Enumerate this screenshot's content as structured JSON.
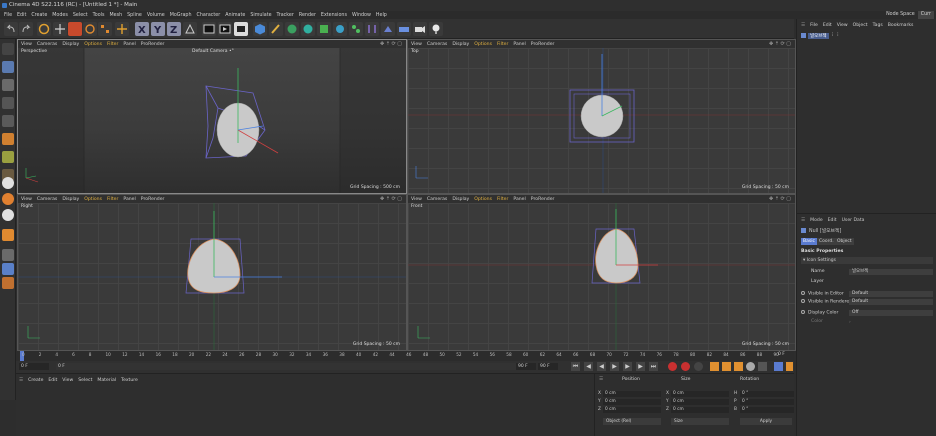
{
  "window": {
    "title": "Cinema 4D S22.116 (RC) - [Untitled 1 *] - Main"
  },
  "menu": [
    "File",
    "Edit",
    "Create",
    "Modes",
    "Select",
    "Tools",
    "Mesh",
    "Spline",
    "Volume",
    "MoGraph",
    "Character",
    "Animate",
    "Simulate",
    "Tracker",
    "Render",
    "Extensions",
    "Window",
    "Help"
  ],
  "layout": {
    "label": "Node Space",
    "value": "Curr"
  },
  "viewport_menu": [
    "View",
    "Cameras",
    "Display",
    "Options",
    "Filter",
    "Panel",
    "ProRender"
  ],
  "viewports": [
    {
      "label": "Perspective",
      "camera": "Default Camera •°",
      "grid": "Grid Spacing : 500 cm"
    },
    {
      "label": "Top",
      "camera": "",
      "grid": "Grid Spacing : 50 cm"
    },
    {
      "label": "Right",
      "camera": "",
      "grid": "Grid Spacing : 50 cm"
    },
    {
      "label": "Front",
      "camera": "",
      "grid": "Grid Spacing : 50 cm"
    }
  ],
  "timeline": {
    "ticks": [
      "0",
      "2",
      "4",
      "6",
      "8",
      "10",
      "12",
      "14",
      "16",
      "18",
      "20",
      "22",
      "24",
      "26",
      "28",
      "30",
      "32",
      "34",
      "36",
      "38",
      "40",
      "42",
      "44",
      "46",
      "48",
      "50",
      "52",
      "54",
      "56",
      "58",
      "60",
      "62",
      "64",
      "66",
      "68",
      "70",
      "72",
      "74",
      "76",
      "78",
      "80",
      "82",
      "84",
      "86",
      "88",
      "90"
    ],
    "current": "0 F"
  },
  "transport": {
    "start": "0 F",
    "start2": "0 F",
    "end": "90 F",
    "end2": "90 F"
  },
  "material_menu": [
    "Create",
    "Edit",
    "View",
    "Select",
    "Material",
    "Texture"
  ],
  "coords": {
    "headers": [
      "Position",
      "Size",
      "Rotation"
    ],
    "rows": [
      {
        "axis": "X",
        "pos": "0 cm",
        "size_axis": "X",
        "size": "0 cm",
        "rot_axis": "H",
        "rot": "0 °"
      },
      {
        "axis": "Y",
        "pos": "0 cm",
        "size_axis": "Y",
        "size": "0 cm",
        "rot_axis": "P",
        "rot": "0 °"
      },
      {
        "axis": "Z",
        "pos": "0 cm",
        "size_axis": "Z",
        "size": "0 cm",
        "rot_axis": "B",
        "rot": "0 °"
      }
    ],
    "mode": "Object (Rel)",
    "size_mode": "Size",
    "apply": "Apply"
  },
  "object_manager": {
    "menu": [
      "File",
      "Edit",
      "View",
      "Object",
      "Tags",
      "Bookmarks"
    ],
    "item": "널오브젝"
  },
  "attributes": {
    "menu": [
      "Mode",
      "Edit",
      "User Data"
    ],
    "object_title": "Null [널오브젝]",
    "tabs": [
      "Basic",
      "Coord.",
      "Object"
    ],
    "section": "Basic Properties",
    "subsection": "▾ Icon Settings",
    "name_label": "Name",
    "name_value": "널오브젝",
    "layer_label": "Layer",
    "vis_editor_label": "Visible in Editor",
    "vis_editor_value": "Default",
    "vis_render_label": "Visible in Renderer",
    "vis_render_value": "Default",
    "display_color_label": "Display Color",
    "display_color_value": "Off",
    "color_label": "Color"
  }
}
